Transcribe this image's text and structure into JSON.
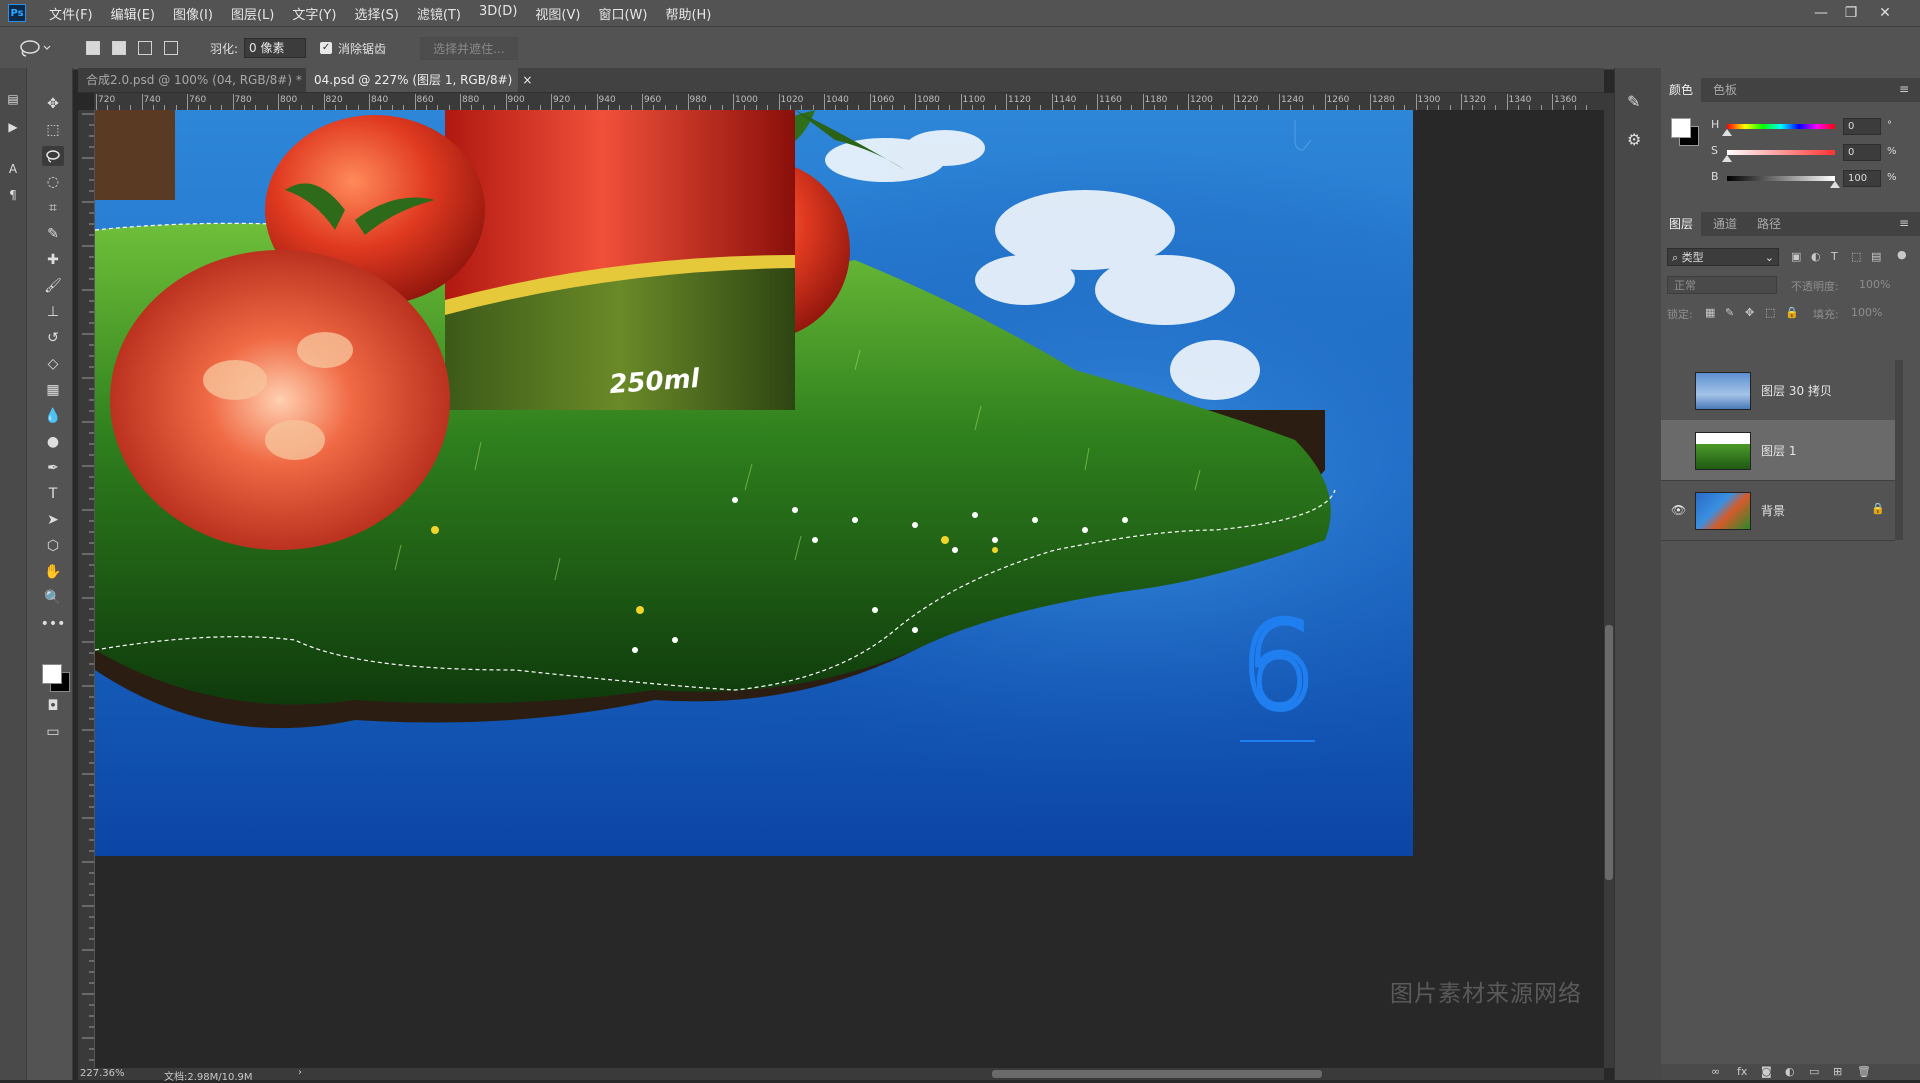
{
  "app": {
    "logo_text": "Ps",
    "menu": [
      "文件(F)",
      "编辑(E)",
      "图像(I)",
      "图层(L)",
      "文字(Y)",
      "选择(S)",
      "滤镜(T)",
      "3D(D)",
      "视图(V)",
      "窗口(W)",
      "帮助(H)"
    ],
    "window_controls": [
      "—",
      "❐",
      "✕"
    ]
  },
  "options_bar": {
    "feather_label": "羽化:",
    "feather_value": "0 像素",
    "antialias_label": "消除锯齿",
    "antialias_checked": true,
    "select_mask_label": "选择并遮住..."
  },
  "tabs": [
    {
      "label": "合成2.0.psd @ 100% (04, RGB/8#) *",
      "active": false
    },
    {
      "label": "04.psd @ 227% (图层 1, RGB/8#)",
      "active": true
    }
  ],
  "ruler": {
    "labels": [
      "720",
      "740",
      "760",
      "780",
      "800",
      "820",
      "840",
      "860",
      "880",
      "900",
      "920",
      "940",
      "960",
      "980",
      "1000",
      "1020",
      "1040",
      "1060",
      "1080",
      "1100",
      "1120",
      "1140",
      "1160",
      "1180",
      "1200",
      "1220",
      "1240",
      "1260",
      "1280",
      "1300",
      "1320",
      "1340",
      "1360"
    ]
  },
  "canvas": {
    "bottle_text": "250ml",
    "number_text": "6",
    "colors": {
      "sky": "#3a8fe0",
      "ground_water": "#0d4fb0",
      "grass": "#2f7a1f",
      "tomato": "#d8321e"
    }
  },
  "watermark": "图片素材来源网络",
  "status": {
    "zoom": "227.36%",
    "doc_size": "文档:2.98M/10.9M"
  },
  "color_panel": {
    "tabs": [
      "颜色",
      "色板"
    ],
    "sliders": [
      {
        "label": "H",
        "value": "0",
        "unit": "°"
      },
      {
        "label": "S",
        "value": "0",
        "unit": "%"
      },
      {
        "label": "B",
        "value": "100",
        "unit": "%"
      }
    ]
  },
  "layers_panel": {
    "tabs": [
      "图层",
      "通道",
      "路径"
    ],
    "filter_label": "类型",
    "blend_mode": "正常",
    "opacity_label": "不透明度:",
    "opacity_value": "100%",
    "lock_label": "锁定:",
    "fill_label": "填充:",
    "fill_value": "100%",
    "layers": [
      {
        "name": "图层 30 拷贝",
        "visible": false,
        "selected": false,
        "locked": false
      },
      {
        "name": "图层 1",
        "visible": false,
        "selected": true,
        "locked": false
      },
      {
        "name": "背景",
        "visible": true,
        "selected": false,
        "locked": true
      }
    ]
  }
}
